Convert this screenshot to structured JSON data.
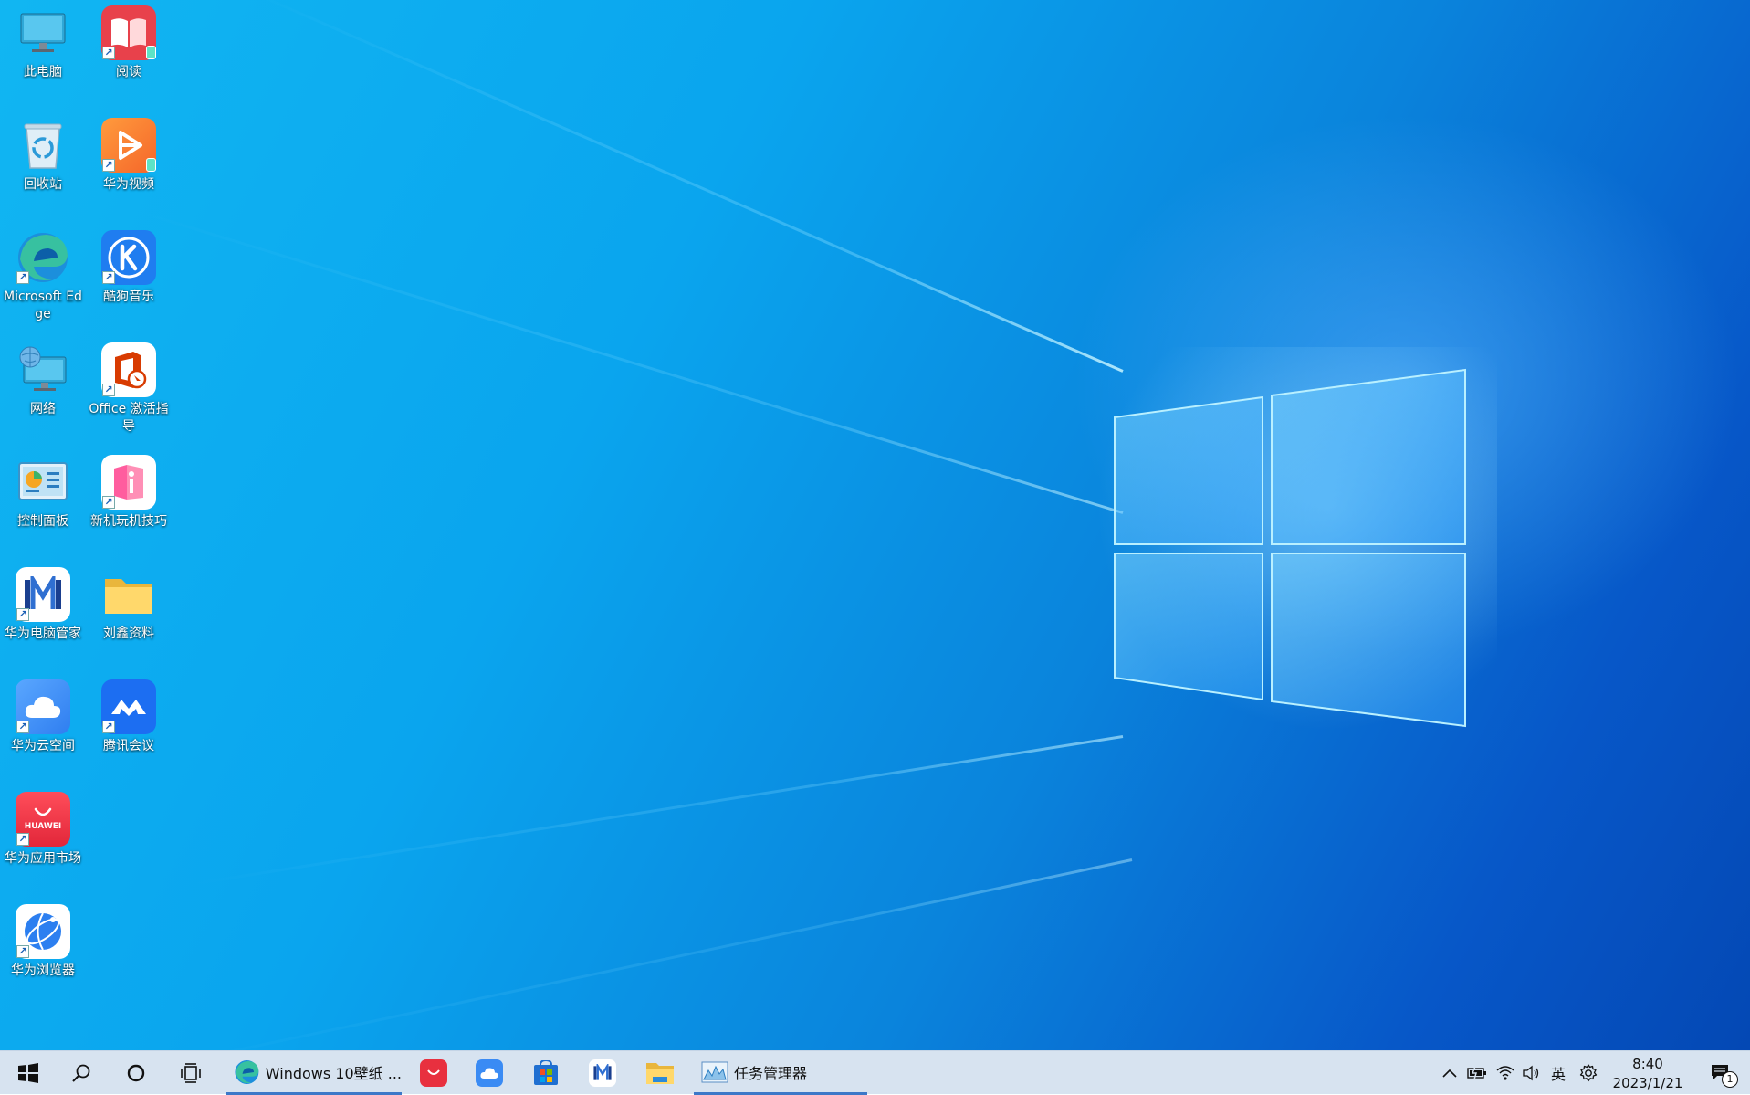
{
  "desktop": {
    "icons": [
      {
        "label": "此电脑",
        "icon": "this-pc-icon"
      },
      {
        "label": "阅读",
        "icon": "reader-icon"
      },
      {
        "label": "回收站",
        "icon": "recycle-bin-icon"
      },
      {
        "label": "华为视频",
        "icon": "huawei-video-icon"
      },
      {
        "label": "Microsoft Edge",
        "icon": "edge-icon"
      },
      {
        "label": "酷狗音乐",
        "icon": "kugou-music-icon"
      },
      {
        "label": "网络",
        "icon": "network-icon"
      },
      {
        "label": "Office 激活指导",
        "icon": "office-activation-icon"
      },
      {
        "label": "控制面板",
        "icon": "control-panel-icon"
      },
      {
        "label": "新机玩机技巧",
        "icon": "tips-icon"
      },
      {
        "label": "华为电脑管家",
        "icon": "pc-manager-icon"
      },
      {
        "label": "刘鑫资料",
        "icon": "folder-icon"
      },
      {
        "label": "华为云空间",
        "icon": "huawei-cloud-icon"
      },
      {
        "label": "腾讯会议",
        "icon": "tencent-meeting-icon"
      },
      {
        "label": "华为应用市场",
        "icon": "appgallery-icon"
      },
      {
        "label": "华为浏览器",
        "icon": "huawei-browser-icon"
      }
    ],
    "appgallery_logo_text": "HUAWEI"
  },
  "taskbar": {
    "edge_window_title": "Windows 10壁纸 ...",
    "task_manager_label": "任务管理器",
    "ime_label": "英",
    "time": "8:40",
    "date": "2023/1/21",
    "notification_count": "1"
  },
  "colors": {
    "taskbar_bg": "#d7e3f0",
    "active_underline": "#3c78c8",
    "desktop_blue": "#0a8fe4"
  }
}
